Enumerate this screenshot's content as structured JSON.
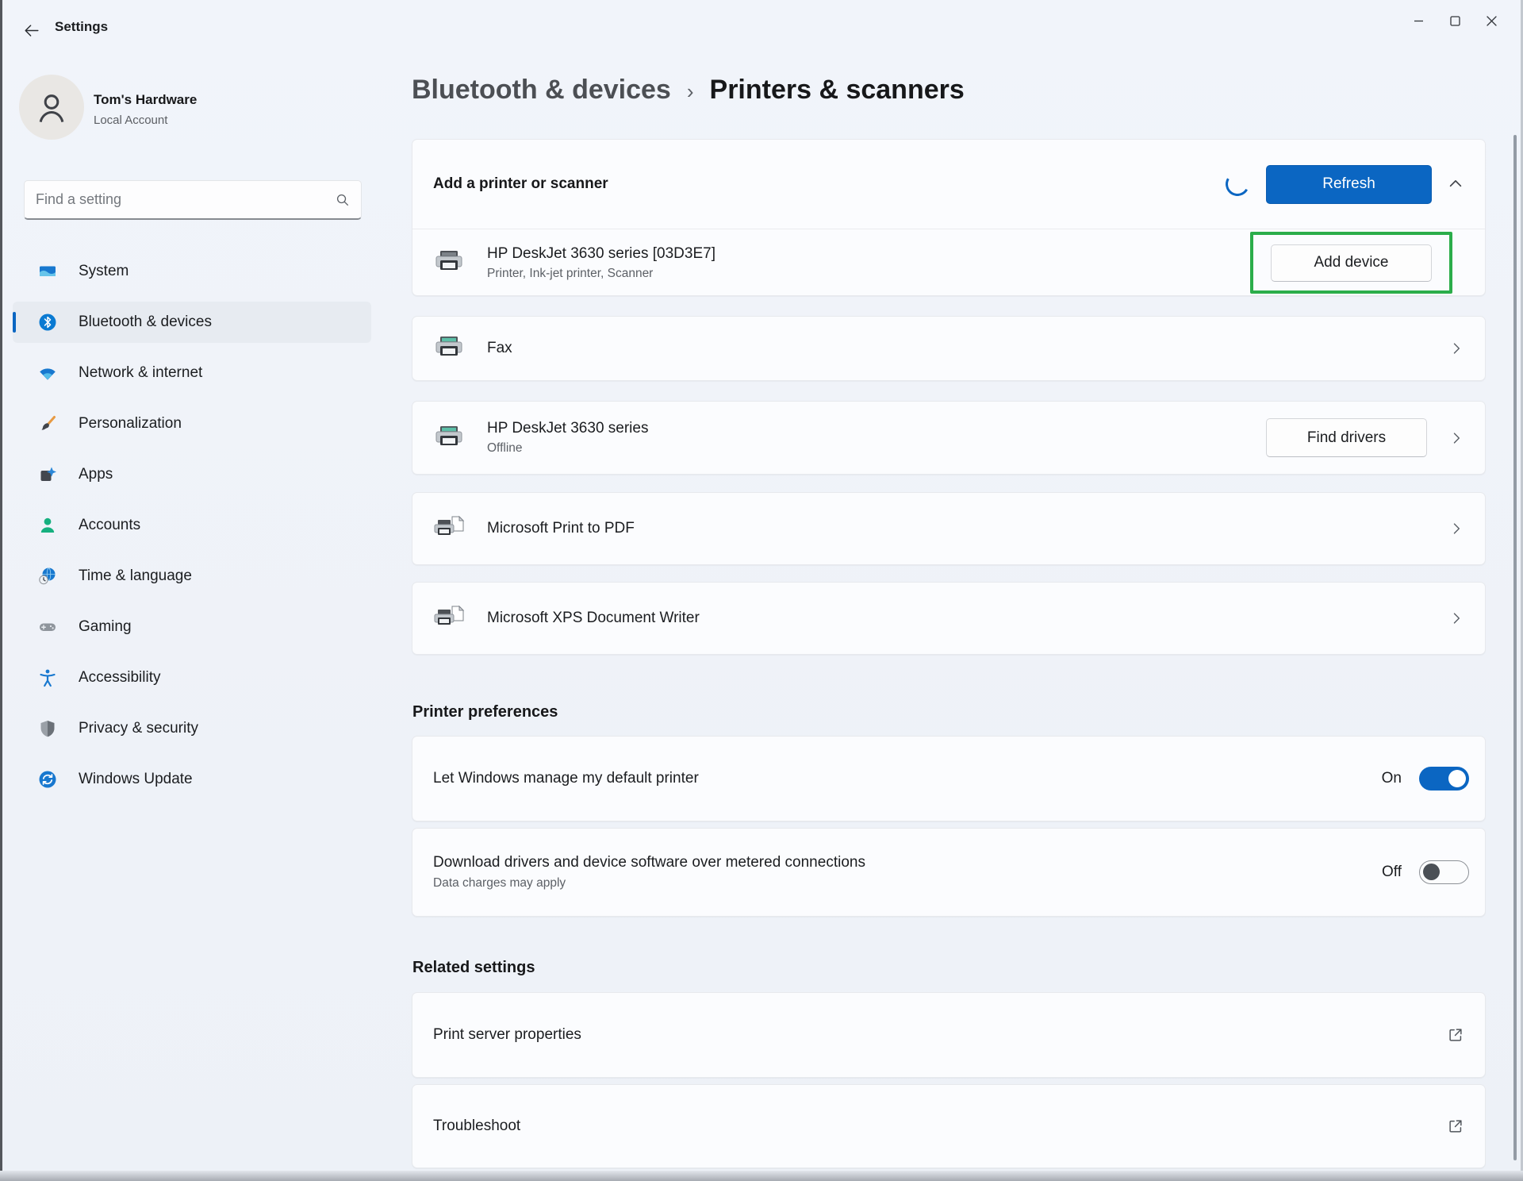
{
  "window": {
    "title": "Settings"
  },
  "account": {
    "name": "Tom's Hardware",
    "type": "Local Account"
  },
  "search": {
    "placeholder": "Find a setting"
  },
  "sidebar": {
    "selected": "Bluetooth & devices",
    "items": [
      {
        "label": "System"
      },
      {
        "label": "Bluetooth & devices"
      },
      {
        "label": "Network & internet"
      },
      {
        "label": "Personalization"
      },
      {
        "label": "Apps"
      },
      {
        "label": "Accounts"
      },
      {
        "label": "Time & language"
      },
      {
        "label": "Gaming"
      },
      {
        "label": "Accessibility"
      },
      {
        "label": "Privacy & security"
      },
      {
        "label": "Windows Update"
      }
    ]
  },
  "breadcrumb": {
    "parent": "Bluetooth & devices",
    "separator": "›",
    "current": "Printers & scanners"
  },
  "add_printer": {
    "label": "Add a printer or scanner",
    "refresh_label": "Refresh",
    "loading": true
  },
  "devices": [
    {
      "name": "HP DeskJet 3630 series [03D3E7]",
      "description": "Printer, Ink-jet printer, Scanner",
      "action": "Add device",
      "highlighted": true
    },
    {
      "name": "Fax"
    },
    {
      "name": "HP DeskJet 3630 series",
      "description": "Offline",
      "action": "Find drivers"
    },
    {
      "name": "Microsoft Print to PDF"
    },
    {
      "name": "Microsoft XPS Document Writer"
    }
  ],
  "printer_preferences": {
    "title": "Printer preferences",
    "rows": [
      {
        "label": "Let Windows manage my default printer",
        "state": "On"
      },
      {
        "label": "Download drivers and device software over metered connections",
        "sublabel": "Data charges may apply",
        "state": "Off"
      }
    ]
  },
  "related_settings": {
    "title": "Related settings",
    "rows": [
      {
        "label": "Print server properties"
      },
      {
        "label": "Troubleshoot"
      }
    ]
  },
  "colors": {
    "accent": "#0b66c2",
    "highlight_green": "#2bad4a",
    "page_bg": "#eff2f8",
    "card_bg": "#fbfcfe"
  }
}
